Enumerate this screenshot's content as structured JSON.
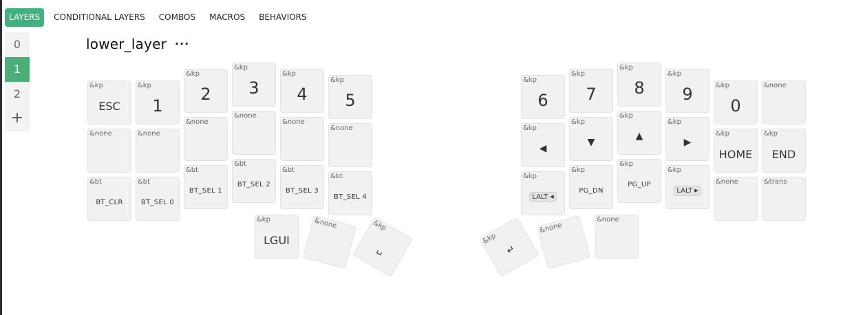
{
  "nav": {
    "tabs": [
      {
        "label": "LAYERS",
        "active": true
      },
      {
        "label": "CONDITIONAL LAYERS",
        "active": false
      },
      {
        "label": "COMBOS",
        "active": false
      },
      {
        "label": "MACROS",
        "active": false
      },
      {
        "label": "BEHAVIORS",
        "active": false
      }
    ]
  },
  "layers": {
    "items": [
      "0",
      "1",
      "2"
    ],
    "active_index": 1,
    "add_label": "+"
  },
  "layer_name": "lower_layer",
  "more_label": "···",
  "colors": {
    "accent": "#3fb27f",
    "key_bg": "#f1f1f1",
    "key_border": "#e2e2e2"
  },
  "keys": {
    "l_esc": {
      "binding": "&kp",
      "label": "ESC"
    },
    "l_1": {
      "binding": "&kp",
      "label": "1"
    },
    "l_2": {
      "binding": "&kp",
      "label": "2"
    },
    "l_3": {
      "binding": "&kp",
      "label": "3"
    },
    "l_4": {
      "binding": "&kp",
      "label": "4"
    },
    "l_5": {
      "binding": "&kp",
      "label": "5"
    },
    "l_r2c0": {
      "binding": "&none",
      "label": ""
    },
    "l_r2c1": {
      "binding": "&none",
      "label": ""
    },
    "l_r2c2": {
      "binding": "&none",
      "label": ""
    },
    "l_r2c3": {
      "binding": "&none",
      "label": ""
    },
    "l_r2c4": {
      "binding": "&none",
      "label": ""
    },
    "l_r2c5": {
      "binding": "&none",
      "label": ""
    },
    "l_btclr": {
      "binding": "&bt",
      "label": "BT_CLR"
    },
    "l_bt0": {
      "binding": "&bt",
      "label": "BT_SEL 0"
    },
    "l_bt1": {
      "binding": "&bt",
      "label": "BT_SEL 1"
    },
    "l_bt2": {
      "binding": "&bt",
      "label": "BT_SEL 2"
    },
    "l_bt3": {
      "binding": "&bt",
      "label": "BT_SEL 3"
    },
    "l_bt4": {
      "binding": "&bt",
      "label": "BT_SEL 4"
    },
    "l_lgui": {
      "binding": "&kp",
      "label": "LGUI"
    },
    "l_tnone": {
      "binding": "&none",
      "label": ""
    },
    "l_space": {
      "binding": "&kp",
      "label": "␣",
      "icon": "space-icon"
    },
    "r_6": {
      "binding": "&kp",
      "label": "6"
    },
    "r_7": {
      "binding": "&kp",
      "label": "7"
    },
    "r_8": {
      "binding": "&kp",
      "label": "8"
    },
    "r_9": {
      "binding": "&kp",
      "label": "9"
    },
    "r_0": {
      "binding": "&kp",
      "label": "0"
    },
    "r_r1none": {
      "binding": "&none",
      "label": ""
    },
    "r_left": {
      "binding": "&kp",
      "label": "◀",
      "icon": "arrow-left-icon"
    },
    "r_down": {
      "binding": "&kp",
      "label": "▼",
      "icon": "arrow-down-icon"
    },
    "r_up": {
      "binding": "&kp",
      "label": "▲",
      "icon": "arrow-up-icon"
    },
    "r_right": {
      "binding": "&kp",
      "label": "▶",
      "icon": "arrow-right-icon"
    },
    "r_home": {
      "binding": "&kp",
      "label": "HOME"
    },
    "r_end": {
      "binding": "&kp",
      "label": "END"
    },
    "r_laltl": {
      "binding": "&kp",
      "label": "LALT",
      "icon": "caret-left-icon",
      "mini": "◀"
    },
    "r_pgdn": {
      "binding": "&kp",
      "label": "PG_DN"
    },
    "r_pgup": {
      "binding": "&kp",
      "label": "PG_UP"
    },
    "r_laltr": {
      "binding": "&kp",
      "label": "LALT",
      "icon": "caret-right-icon",
      "mini": "▶"
    },
    "r_r3none": {
      "binding": "&none",
      "label": ""
    },
    "r_trans": {
      "binding": "&trans",
      "label": ""
    },
    "r_enter": {
      "binding": "&kp",
      "label": "↵",
      "icon": "enter-icon"
    },
    "r_tnone1": {
      "binding": "&none",
      "label": ""
    },
    "r_tnone2": {
      "binding": "&none",
      "label": ""
    }
  }
}
